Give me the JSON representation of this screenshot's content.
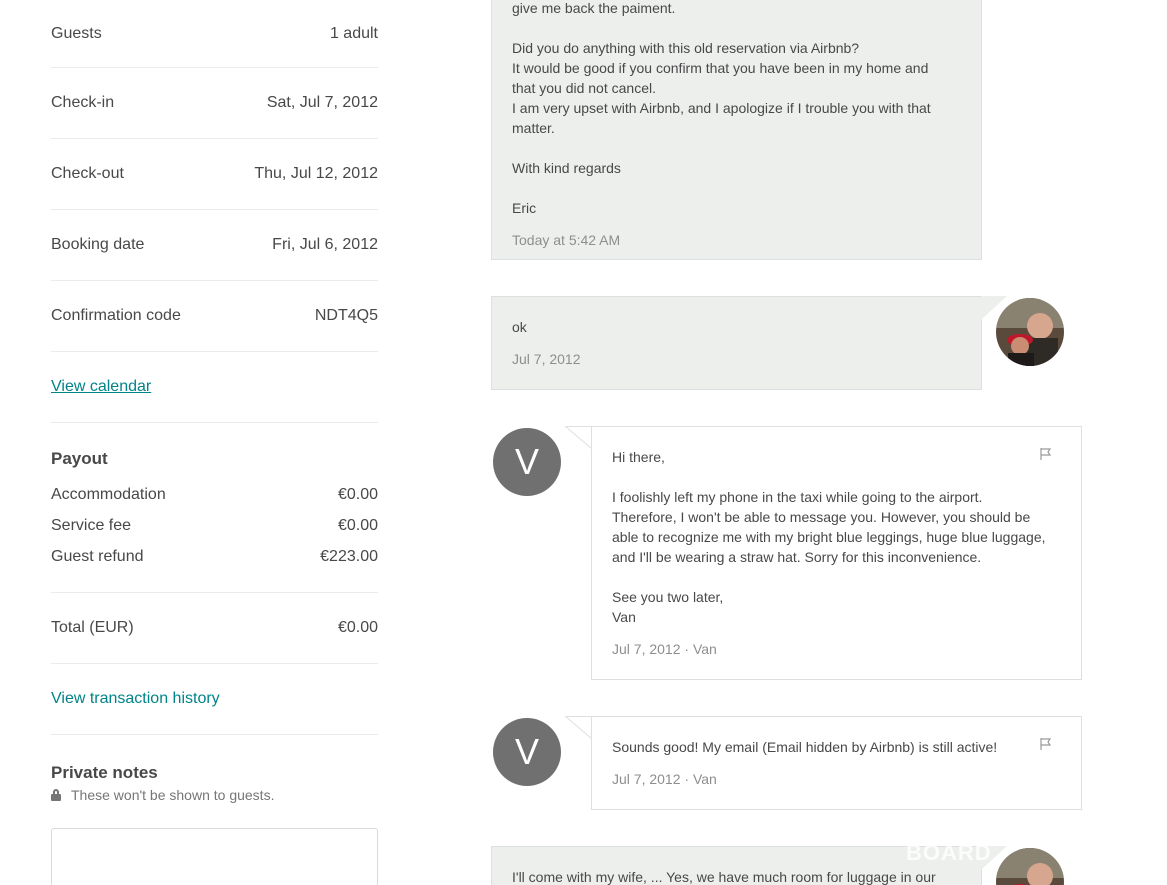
{
  "details": [
    {
      "label": "Guests",
      "value": "1 adult"
    },
    {
      "label": "Check-in",
      "value": "Sat, Jul 7, 2012"
    },
    {
      "label": "Check-out",
      "value": "Thu, Jul 12, 2012"
    },
    {
      "label": "Booking date",
      "value": "Fri, Jul 6, 2012"
    },
    {
      "label": "Confirmation code",
      "value": "NDT4Q5"
    }
  ],
  "view_calendar": "View calendar",
  "payout": {
    "title": "Payout",
    "rows": [
      {
        "label": "Accommodation",
        "value": "€0.00"
      },
      {
        "label": "Service fee",
        "value": "€0.00"
      },
      {
        "label": "Guest refund",
        "value": "€223.00"
      }
    ],
    "total_label": "Total (EUR)",
    "total_value": "€0.00"
  },
  "view_transaction_history": "View transaction history",
  "private_notes": {
    "title": "Private notes",
    "hint": "These won't be shown to guests."
  },
  "messages": [
    {
      "text": "give me back the paiment.\n\nDid you do anything with this old reservation via Airbnb?\nIt would be good if you confirm that you have been in my home and\nthat you did not cancel.\nI am very upset with Airbnb, and I apologize if I trouble you with that\nmatter.\n\nWith kind regards\n\nEric",
      "meta": "Today at 5:42 AM"
    },
    {
      "text": "ok",
      "meta": "Jul 7, 2012"
    },
    {
      "avatar": "V",
      "text": "Hi there,\n\nI foolishly left my phone in the taxi while going to the airport.\nTherefore, I won't be able to message you. However, you should be\nable to recognize me with my bright blue leggings, huge blue luggage,\nand I'll be wearing a straw hat. Sorry for this inconvenience.\n\nSee you two later,\nVan",
      "meta": "Jul 7, 2012 · Van"
    },
    {
      "avatar": "V",
      "text": "Sounds good! My email (Email hidden by Airbnb) is still active!",
      "meta": "Jul 7, 2012 · Van"
    },
    {
      "text": "I'll come with my wife, ... Yes, we have much room for luggage in our"
    }
  ],
  "watermark": "BOARD",
  "colors": {
    "link": "#008489",
    "host_bubble": "#edefed",
    "avatar_grey": "#707070"
  }
}
